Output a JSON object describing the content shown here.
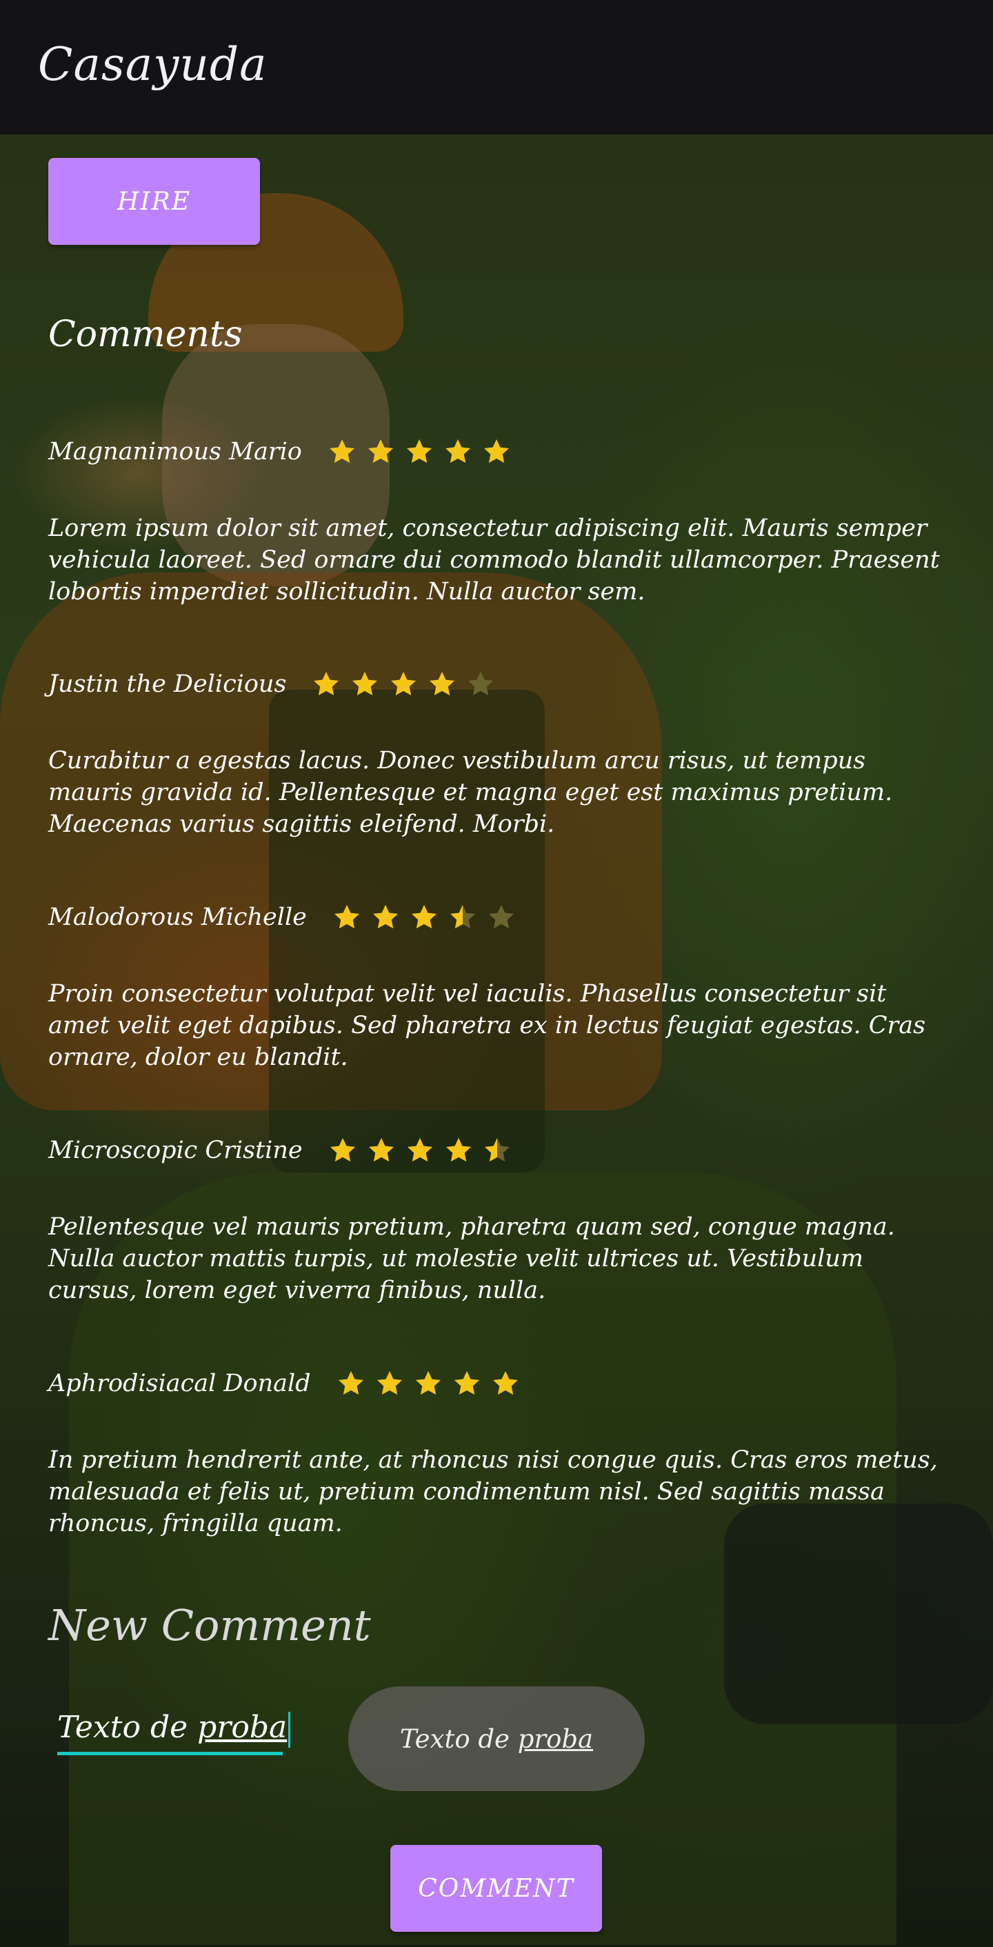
{
  "app": {
    "title": "Casayuda"
  },
  "hire_button": {
    "label": "HIRE"
  },
  "comments_section": {
    "title": "Comments"
  },
  "reviews": [
    {
      "name": "Magnanimous Mario",
      "rating": 5,
      "text": "Lorem ipsum dolor sit amet, consectetur adipiscing elit. Mauris semper vehicula laoreet. Sed ornare dui commodo blandit ullamcorper. Praesent lobortis imperdiet sollicitudin. Nulla auctor sem."
    },
    {
      "name": "Justin the Delicious",
      "rating": 4,
      "text": "Curabitur a egestas lacus. Donec vestibulum arcu risus, ut tempus mauris gravida id. Pellentesque et magna eget est maximus pretium. Maecenas varius sagittis eleifend. Morbi."
    },
    {
      "name": "Malodorous Michelle",
      "rating": 3.5,
      "text": "Proin consectetur volutpat velit vel iaculis. Phasellus consectetur sit amet velit eget dapibus. Sed pharetra ex in lectus feugiat egestas. Cras ornare, dolor eu blandit."
    },
    {
      "name": "Microscopic Cristine",
      "rating": 4.5,
      "text": "Pellentesque vel mauris pretium, pharetra quam sed, congue magna. Nulla auctor mattis turpis, ut molestie velit ultrices ut. Vestibulum cursus, lorem eget viverra finibus, nulla."
    },
    {
      "name": "Aphrodisiacal Donald",
      "rating": 5,
      "text": "In pretium hendrerit ante, at rhoncus nisi congue quis. Cras eros metus, malesuada et felis ut, pretium condimentum nisl. Sed sagittis massa rhoncus, fringilla quam."
    }
  ],
  "new_comment": {
    "title": "New Comment",
    "input_value_prefix": "Texto de ",
    "input_value_word": "proba",
    "pill_value_prefix": "Texto de ",
    "pill_value_word": "proba",
    "submit_label": "COMMENT"
  },
  "colors": {
    "accent": "#bf82ff",
    "appbar": "#131216",
    "star_filled": "#f5c518",
    "star_empty": "#6b6430",
    "input_underline": "#19c8c4"
  },
  "icons": {
    "rating": "star-icon"
  }
}
